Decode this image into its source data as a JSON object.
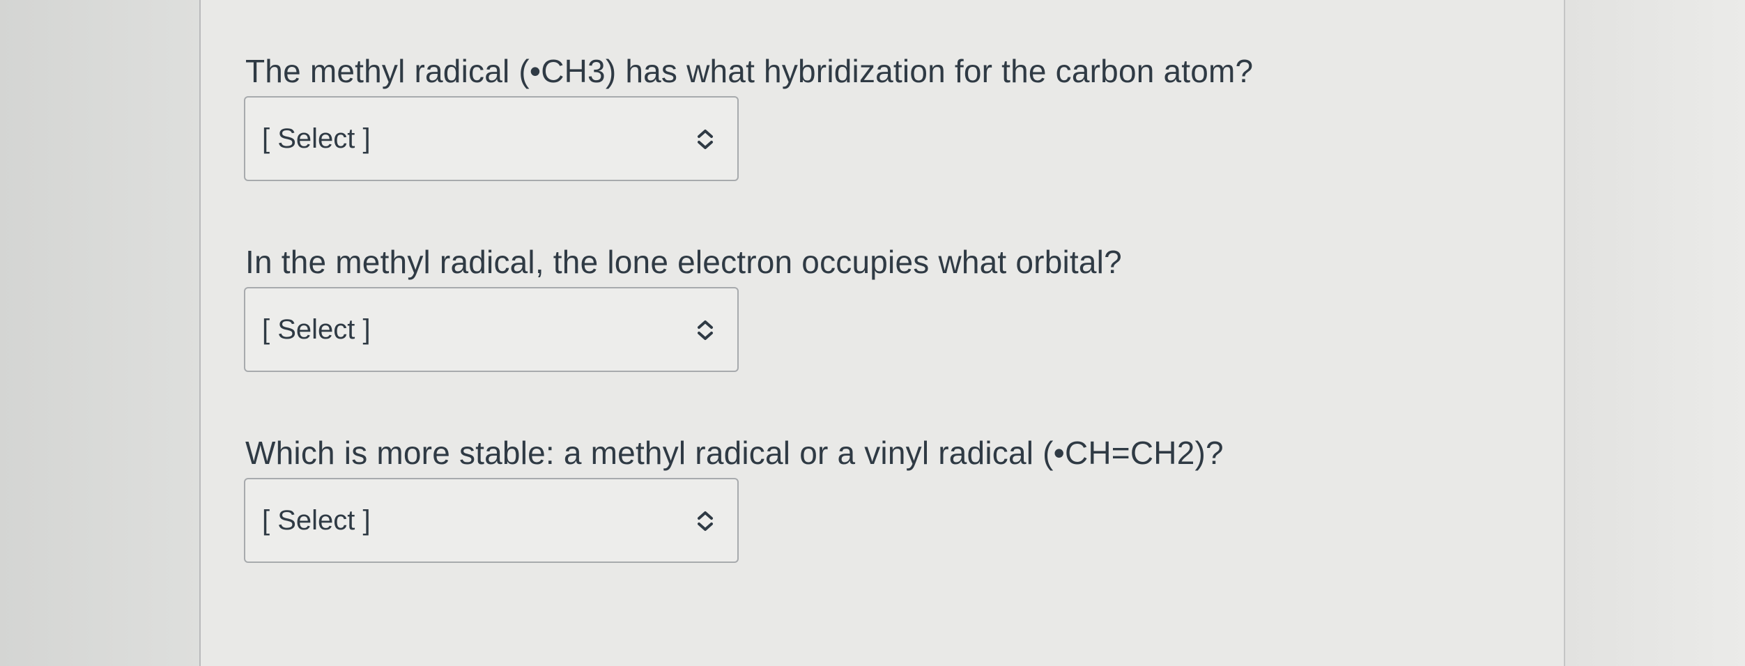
{
  "questions": [
    {
      "prompt": "The methyl radical (•CH3) has what hybridization for the carbon atom?",
      "select_value": "[ Select ]"
    },
    {
      "prompt": "In the methyl radical, the lone electron occupies what orbital?",
      "select_value": "[ Select ]"
    },
    {
      "prompt": "Which is more stable: a methyl radical or a vinyl radical (•CH=CH2)?",
      "select_value": "[ Select ]"
    }
  ],
  "icons": {
    "select_indicator": "chevron-up-down-icon"
  }
}
